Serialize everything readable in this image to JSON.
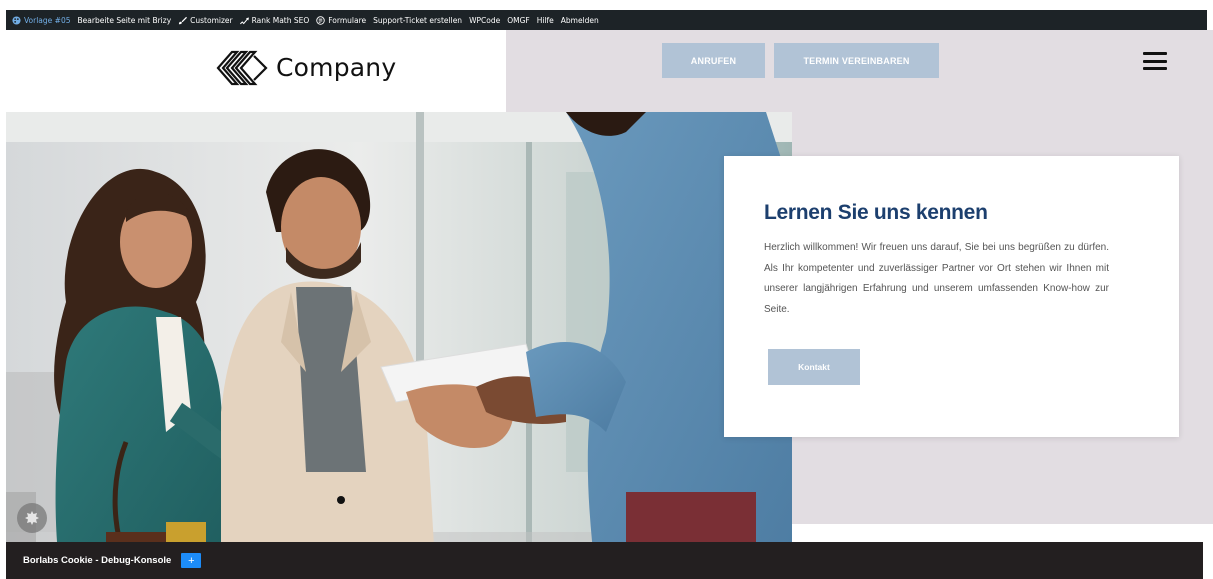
{
  "adminbar": {
    "items": [
      {
        "label": "Vorlage #05",
        "icon": "palette-icon"
      },
      {
        "label": "Bearbeite Seite mit Brizy",
        "icon": ""
      },
      {
        "label": "Customizer",
        "icon": "brush-icon"
      },
      {
        "label": "Rank Math SEO",
        "icon": "rank-math-icon"
      },
      {
        "label": "Formulare",
        "icon": "forms-icon"
      },
      {
        "label": "Support-Ticket erstellen",
        "icon": ""
      },
      {
        "label": "WPCode",
        "icon": ""
      },
      {
        "label": "OMGF",
        "icon": ""
      },
      {
        "label": "Hilfe",
        "icon": ""
      },
      {
        "label": "Abmelden",
        "icon": ""
      }
    ]
  },
  "header": {
    "logo_text": "Company",
    "call_label": "ANRUFEN",
    "termin_label": "TERMIN VEREINBAREN"
  },
  "hero": {
    "title": "Lernen Sie uns kennen",
    "text": "Herzlich willkommen! Wir freuen uns darauf, Sie bei uns begrüßen zu dürfen. Als Ihr kompetenter und zuverlässiger Partner vor Ort stehen wir Ihnen mit unserer langjährigen Erfahrung und unserem umfassenden Know-how zur Seite.",
    "button_label": "Kontakt"
  },
  "cookiebar": {
    "title": "Borlabs Cookie - Debug-Konsole",
    "plus": "+"
  },
  "colors": {
    "adminbar": "#1d2327",
    "hero_bg": "#e2dde2",
    "button": "#b1c3d6",
    "title": "#1c3f6e",
    "cookiebar": "#231f20"
  }
}
